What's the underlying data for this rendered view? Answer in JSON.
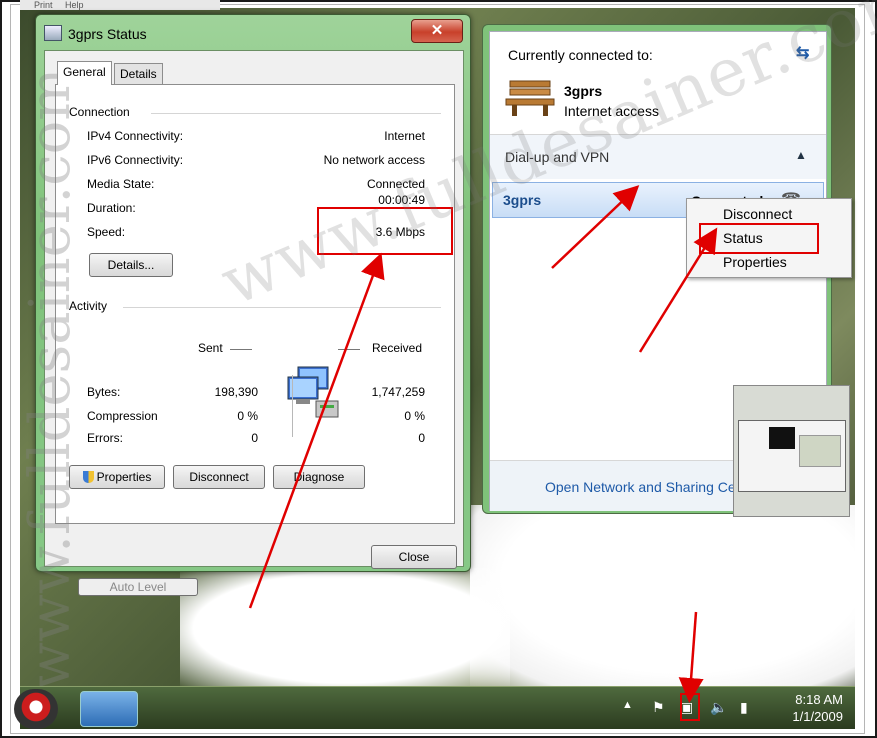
{
  "top_strip": {
    "print_label": "Print",
    "help_label": "Help"
  },
  "status_window": {
    "title": "3gprs Status",
    "close_glyph": "✕",
    "tabs": [
      "General",
      "Details"
    ],
    "connection": {
      "group_label": "Connection",
      "rows": [
        {
          "label": "IPv4 Connectivity:",
          "value": "Internet"
        },
        {
          "label": "IPv6 Connectivity:",
          "value": "No network access"
        },
        {
          "label": "Media State:",
          "value": "Connected"
        },
        {
          "label": "Duration:",
          "value": "00:00:49"
        },
        {
          "label": "Speed:",
          "value": "3.6 Mbps"
        }
      ],
      "details_button": "Details..."
    },
    "activity": {
      "group_label": "Activity",
      "sent_label": "Sent",
      "received_label": "Received",
      "rows": [
        {
          "label": "Bytes:",
          "sent": "198,390",
          "received": "1,747,259"
        },
        {
          "label": "Compression",
          "sent": "0 %",
          "received": "0 %"
        },
        {
          "label": "Errors:",
          "sent": "0",
          "received": "0"
        }
      ]
    },
    "buttons": {
      "properties": "Properties",
      "disconnect": "Disconnect",
      "diagnose": "Diagnose"
    },
    "close_button": "Close"
  },
  "flyout": {
    "header": "Currently connected to:",
    "connection_name": "3gprs",
    "connection_status": "Internet access",
    "section_title": "Dial-up and VPN",
    "item_name": "3gprs",
    "item_state": "Connected",
    "open_link": "Open Network and Sharing Center"
  },
  "context_menu": {
    "items": [
      "Disconnect",
      "Status",
      "Properties"
    ]
  },
  "background": {
    "auto_level_label": "Auto Level"
  },
  "taskbar": {
    "time": "8:18 AM",
    "date": "1/1/2009"
  },
  "watermark": {
    "text": "www.fulldesainer.com"
  },
  "colors": {
    "highlight_red": "#e00000",
    "window_green": "#7fc27a",
    "link_blue": "#1e5aa8"
  }
}
